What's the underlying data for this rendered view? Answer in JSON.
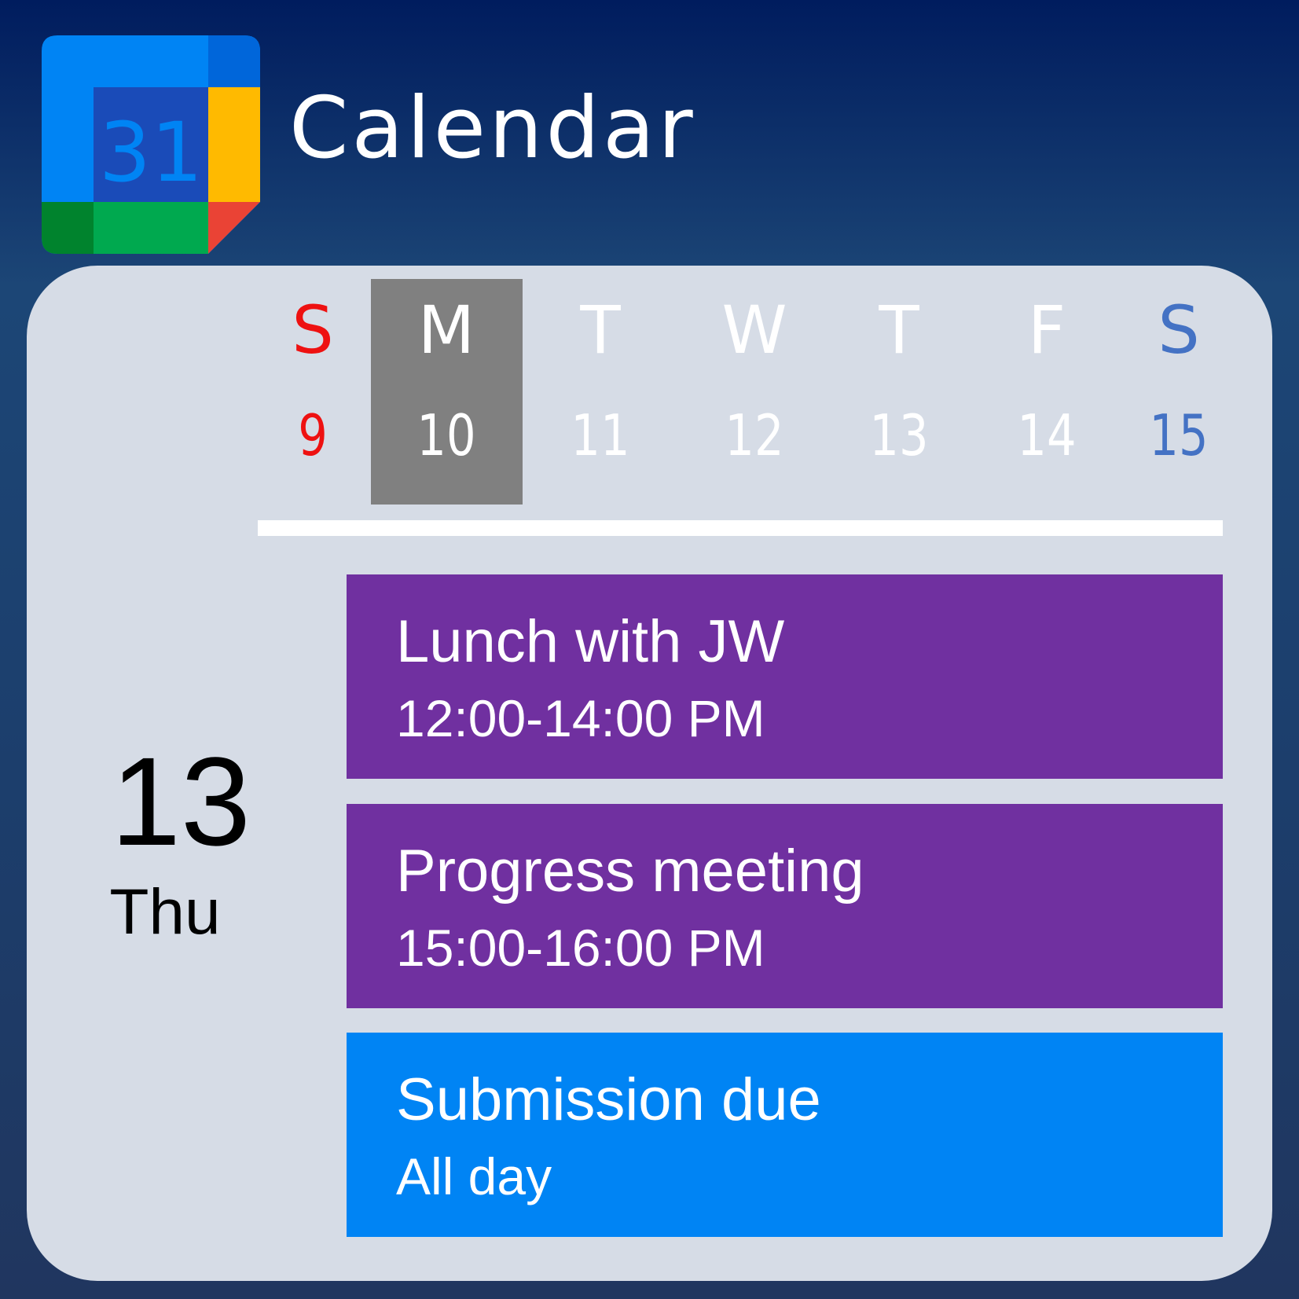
{
  "app": {
    "title": "Calendar",
    "icon": {
      "name": "google-calendar-icon",
      "number": "31"
    }
  },
  "colors": {
    "sunday": "#ee1111",
    "saturday": "#4472c4",
    "today_highlight": "#808080",
    "event_purple": "#7030a0",
    "event_blue": "#0084f4",
    "panel": "#d6dce6"
  },
  "week": {
    "days": [
      {
        "letter": "S",
        "number": "9"
      },
      {
        "letter": "M",
        "number": "10"
      },
      {
        "letter": "T",
        "number": "11"
      },
      {
        "letter": "W",
        "number": "12"
      },
      {
        "letter": "T",
        "number": "13"
      },
      {
        "letter": "F",
        "number": "14"
      },
      {
        "letter": "S",
        "number": "15"
      }
    ],
    "today_index": 1
  },
  "selected": {
    "date": "13",
    "weekday": "Thu"
  },
  "events": [
    {
      "title": "Lunch with JW",
      "time": "12:00-14:00 PM",
      "color": "#7030a0"
    },
    {
      "title": "Progress meeting",
      "time": "15:00-16:00 PM",
      "color": "#7030a0"
    },
    {
      "title": "Submission due",
      "time": "All day",
      "color": "#0084f4"
    }
  ]
}
